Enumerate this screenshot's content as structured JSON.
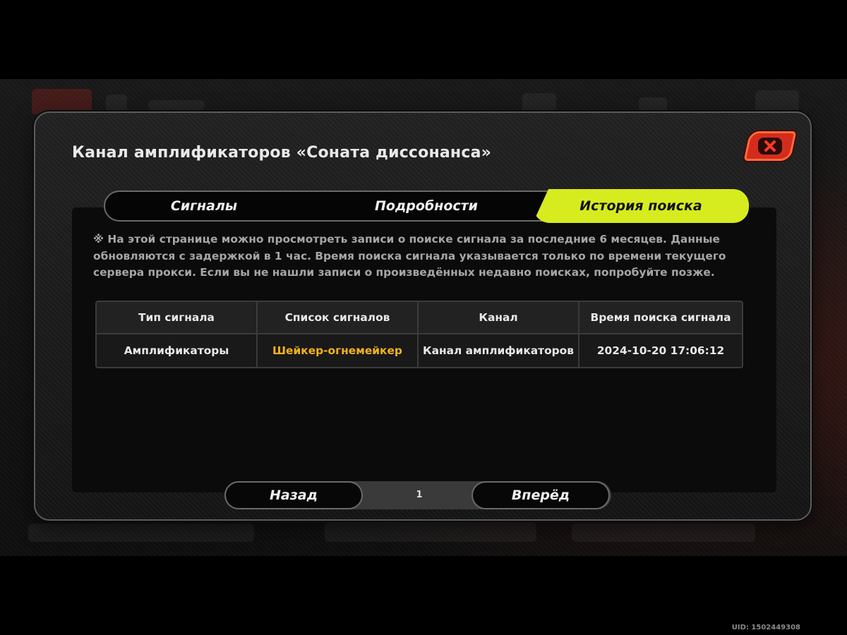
{
  "modal": {
    "title": "Канал амплификаторов «Соната диссонанса»"
  },
  "tabs": [
    {
      "label": "Сигналы",
      "active": false
    },
    {
      "label": "Подробности",
      "active": false
    },
    {
      "label": "История поиска",
      "active": true
    }
  ],
  "notice": "※ На этой странице можно просмотреть записи о поиске сигнала за последние 6 месяцев. Данные обновляются с задержкой в 1 час. Время поиска сигнала указывается только по времени текущего сервера прокси. Если вы не нашли записи о произведённых недавно поисках, попробуйте позже.",
  "table": {
    "headers": [
      "Тип сигнала",
      "Список сигналов",
      "Канал",
      "Время поиска сигнала"
    ],
    "rows": [
      [
        "Амплификаторы",
        "Шейкер-огнемейкер",
        "Канал амплификаторов",
        "2024-10-20 17:06:12"
      ]
    ]
  },
  "pagination": {
    "prev_label": "Назад",
    "page": "1",
    "next_label": "Вперёд"
  },
  "footer": {
    "uid": "UID: 1502449308"
  },
  "colors": {
    "accent": "#d7ec1f",
    "highlight": "#f5b21c",
    "close": "#d42c1c"
  },
  "icons": {
    "close": "close-icon"
  }
}
